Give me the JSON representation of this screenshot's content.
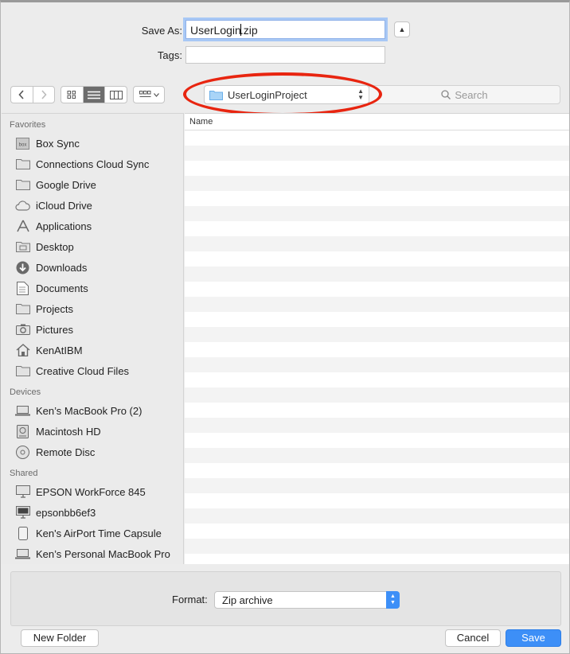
{
  "header": {
    "save_as_label": "Save As:",
    "filename_before_cursor": "UserLogin",
    "filename_after_cursor": ".zip",
    "tags_label": "Tags:",
    "tags_value": ""
  },
  "toolbar": {
    "back_icon": "chevron-left-icon",
    "forward_icon": "chevron-right-icon",
    "location": "UserLoginProject",
    "search_placeholder": "Search"
  },
  "sidebar": {
    "favorites": {
      "heading": "Favorites",
      "items": [
        {
          "label": "Box Sync",
          "icon": "box-icon"
        },
        {
          "label": "Connections Cloud Sync",
          "icon": "folder-icon"
        },
        {
          "label": "Google Drive",
          "icon": "folder-icon"
        },
        {
          "label": "iCloud Drive",
          "icon": "cloud-icon"
        },
        {
          "label": "Applications",
          "icon": "applications-icon"
        },
        {
          "label": "Desktop",
          "icon": "desktop-folder-icon"
        },
        {
          "label": "Downloads",
          "icon": "downloads-icon"
        },
        {
          "label": "Documents",
          "icon": "documents-icon"
        },
        {
          "label": "Projects",
          "icon": "folder-icon"
        },
        {
          "label": "Pictures",
          "icon": "camera-icon"
        },
        {
          "label": "KenAtIBM",
          "icon": "home-icon"
        },
        {
          "label": "Creative Cloud Files",
          "icon": "folder-icon"
        }
      ]
    },
    "devices": {
      "heading": "Devices",
      "items": [
        {
          "label": "Ken’s MacBook Pro (2)",
          "icon": "laptop-icon"
        },
        {
          "label": "Macintosh HD",
          "icon": "hard-drive-icon"
        },
        {
          "label": "Remote Disc",
          "icon": "disc-icon"
        }
      ]
    },
    "shared": {
      "heading": "Shared",
      "items": [
        {
          "label": "EPSON WorkForce 845",
          "icon": "display-icon"
        },
        {
          "label": "epsonbb6ef3",
          "icon": "display-icon"
        },
        {
          "label": "Ken's AirPort Time Capsule",
          "icon": "time-capsule-icon"
        },
        {
          "label": "Ken’s Personal MacBook Pro",
          "icon": "laptop-icon"
        }
      ]
    }
  },
  "file_list": {
    "column_name": "Name"
  },
  "footer": {
    "format_label": "Format:",
    "format_value": "Zip archive",
    "new_folder": "New Folder",
    "cancel": "Cancel",
    "save": "Save"
  },
  "colors": {
    "accent": "#3d8ff7",
    "highlight": "#e82510"
  }
}
